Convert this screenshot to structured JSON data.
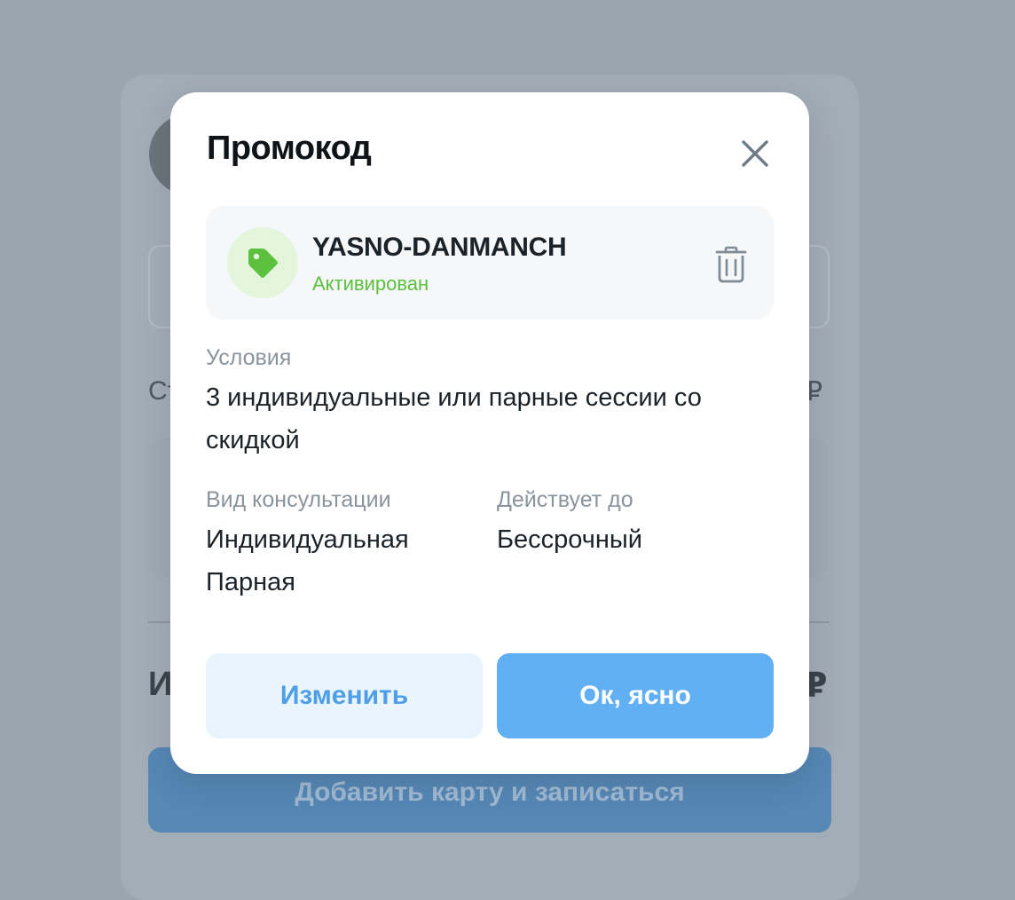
{
  "background": {
    "sub_left": "Стоимость",
    "sub_right": "₽",
    "total_left": "Итого",
    "total_right": "₽",
    "button_label": "Добавить карту и записаться"
  },
  "modal": {
    "title": "Промокод",
    "promo": {
      "code": "YASNO-DANMANCH",
      "status": "Активирован"
    },
    "conditions": {
      "label": "Условия",
      "value": "3 индивидуальные или парные сессии со скидкой"
    },
    "consultation_type": {
      "label": "Вид консультации",
      "values": [
        "Индивидуальная",
        "Парная"
      ]
    },
    "valid_until": {
      "label": "Действует до",
      "value": "Бессрочный"
    },
    "buttons": {
      "change": "Изменить",
      "ok": "Ок, ясно"
    }
  },
  "colors": {
    "overlay": "#9aa5ae",
    "accent": "#62b0f4",
    "accent_text": "#4f9ee8",
    "success": "#5cbf3d"
  },
  "icons": {
    "close": "close-icon",
    "tag": "tag-icon",
    "delete": "trash-icon"
  }
}
